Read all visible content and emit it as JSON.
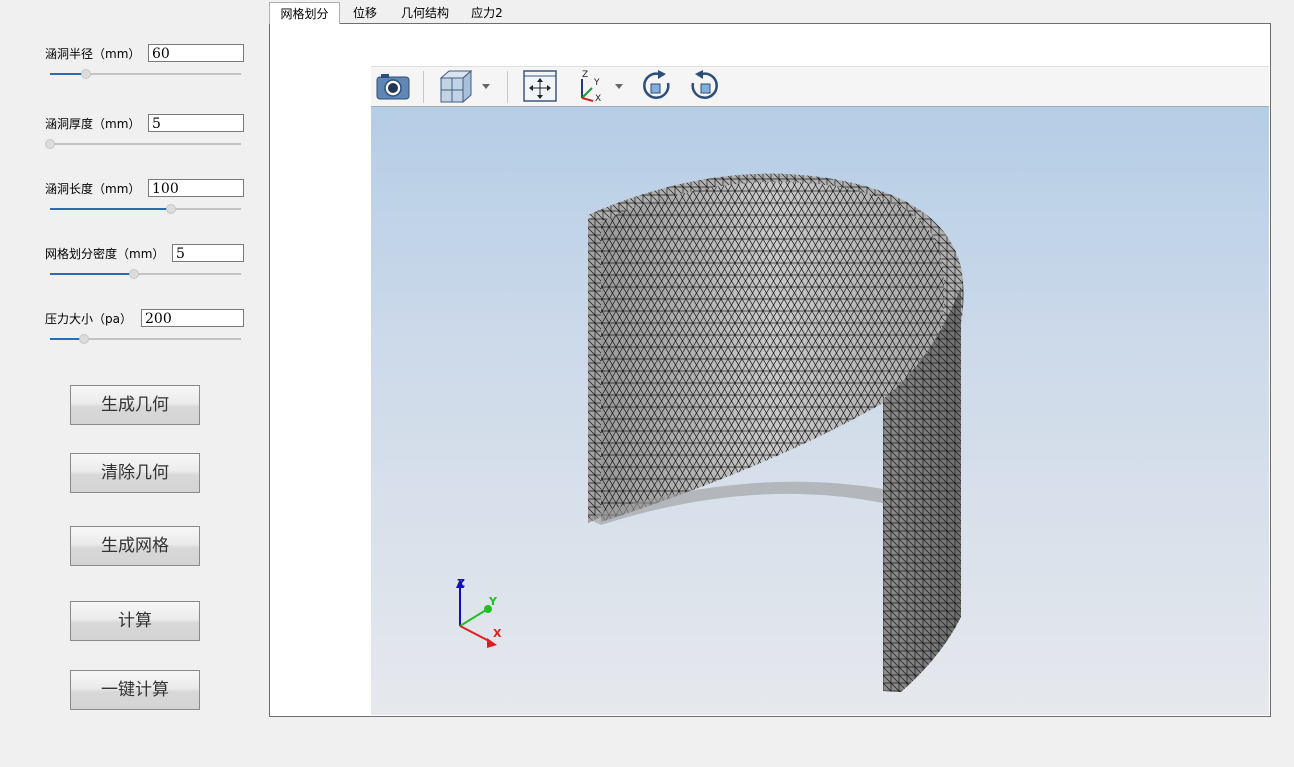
{
  "params": [
    {
      "label": "涵洞半径（mm）",
      "value": "60",
      "slider_fraction": 0.19
    },
    {
      "label": "涵洞厚度（mm）",
      "value": "5",
      "slider_fraction": 0.0
    },
    {
      "label": "涵洞长度（mm）",
      "value": "100",
      "slider_fraction": 0.64
    },
    {
      "label": "网格划分密度（mm）",
      "value": "5",
      "slider_fraction": 0.44
    },
    {
      "label": "压力大小（pa）",
      "value": "200",
      "slider_fraction": 0.18
    }
  ],
  "buttons": {
    "gen_geometry": "生成几何",
    "clear_geometry": "清除几何",
    "gen_mesh": "生成网格",
    "compute": "计算",
    "one_click_compute": "一键计算"
  },
  "tabs": [
    "网格划分",
    "位移",
    "几何结构",
    "应力2"
  ],
  "active_tab": "网格划分",
  "toolbar_icons": [
    "camera-icon",
    "view-cube-icon",
    "fit-view-icon",
    "axes-orientation-icon",
    "rotate-cw-icon",
    "rotate-ccw-icon"
  ],
  "axes": {
    "x": "X",
    "y": "Y",
    "z": "Z"
  },
  "colors": {
    "accent": "#2b6cb0",
    "mesh_fill": "#b9b9b9",
    "axis_x": "#e02020",
    "axis_y": "#20c020",
    "axis_z": "#1010c0"
  }
}
